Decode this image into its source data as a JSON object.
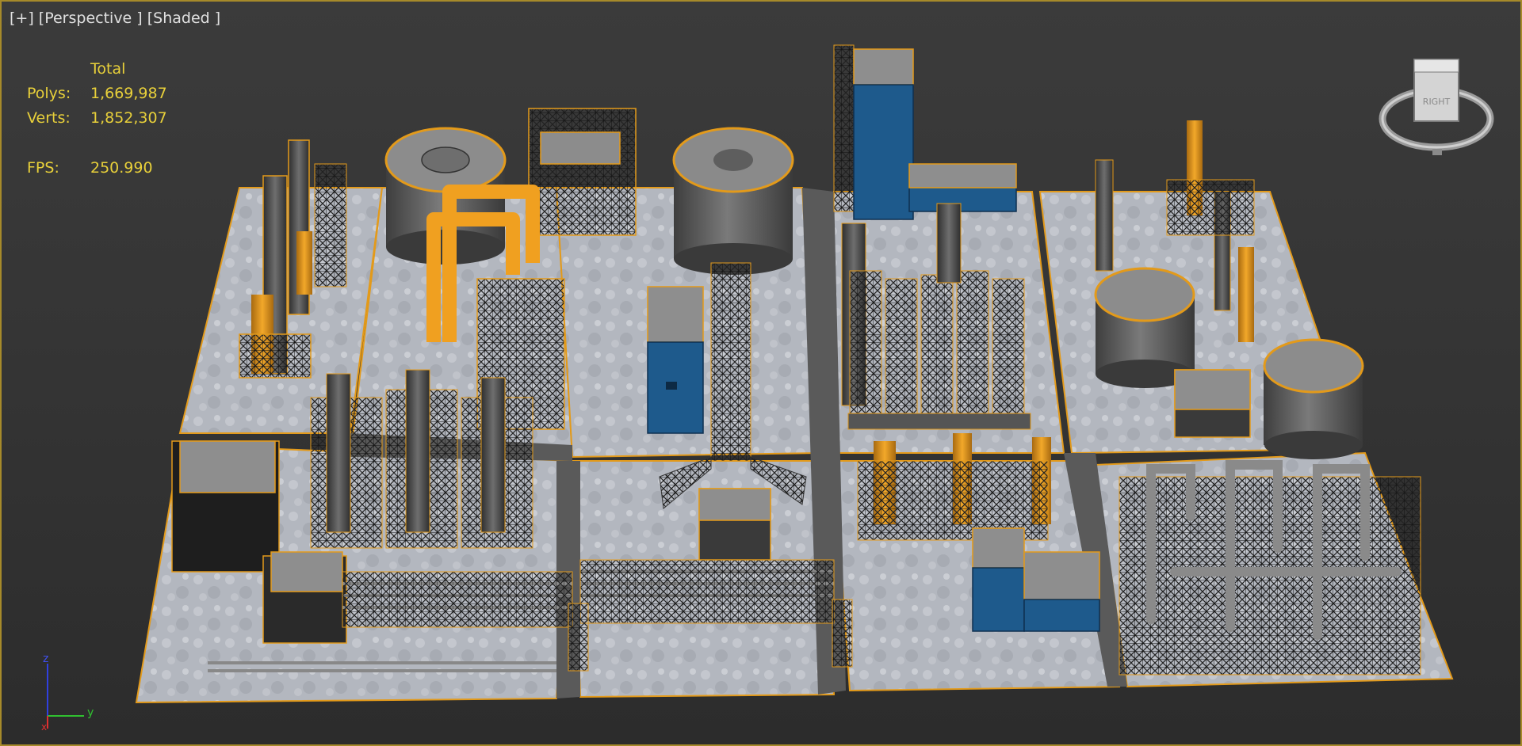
{
  "viewport": {
    "menu_plus": "[+]",
    "view_mode": "[Perspective ]",
    "shading_mode": "[Shaded ]"
  },
  "stats": {
    "total_label": "Total",
    "polys_label": "Polys:",
    "polys_value": "1,669,987",
    "verts_label": "Verts:",
    "verts_value": "1,852,307",
    "fps_label": "FPS:",
    "fps_value": "250.990"
  },
  "viewcube": {
    "face_label": "RIGHT",
    "icon": "viewcube-icon"
  },
  "axis_tripod": {
    "x_label": "x",
    "y_label": "y",
    "z_label": "z"
  },
  "colors": {
    "viewport_border": "#a68a2a",
    "selection_orange": "#e39a1a",
    "stats_text": "#e8d03a",
    "blue_building": "#1e5a8c",
    "ground_slab": "#b9bcc4"
  }
}
